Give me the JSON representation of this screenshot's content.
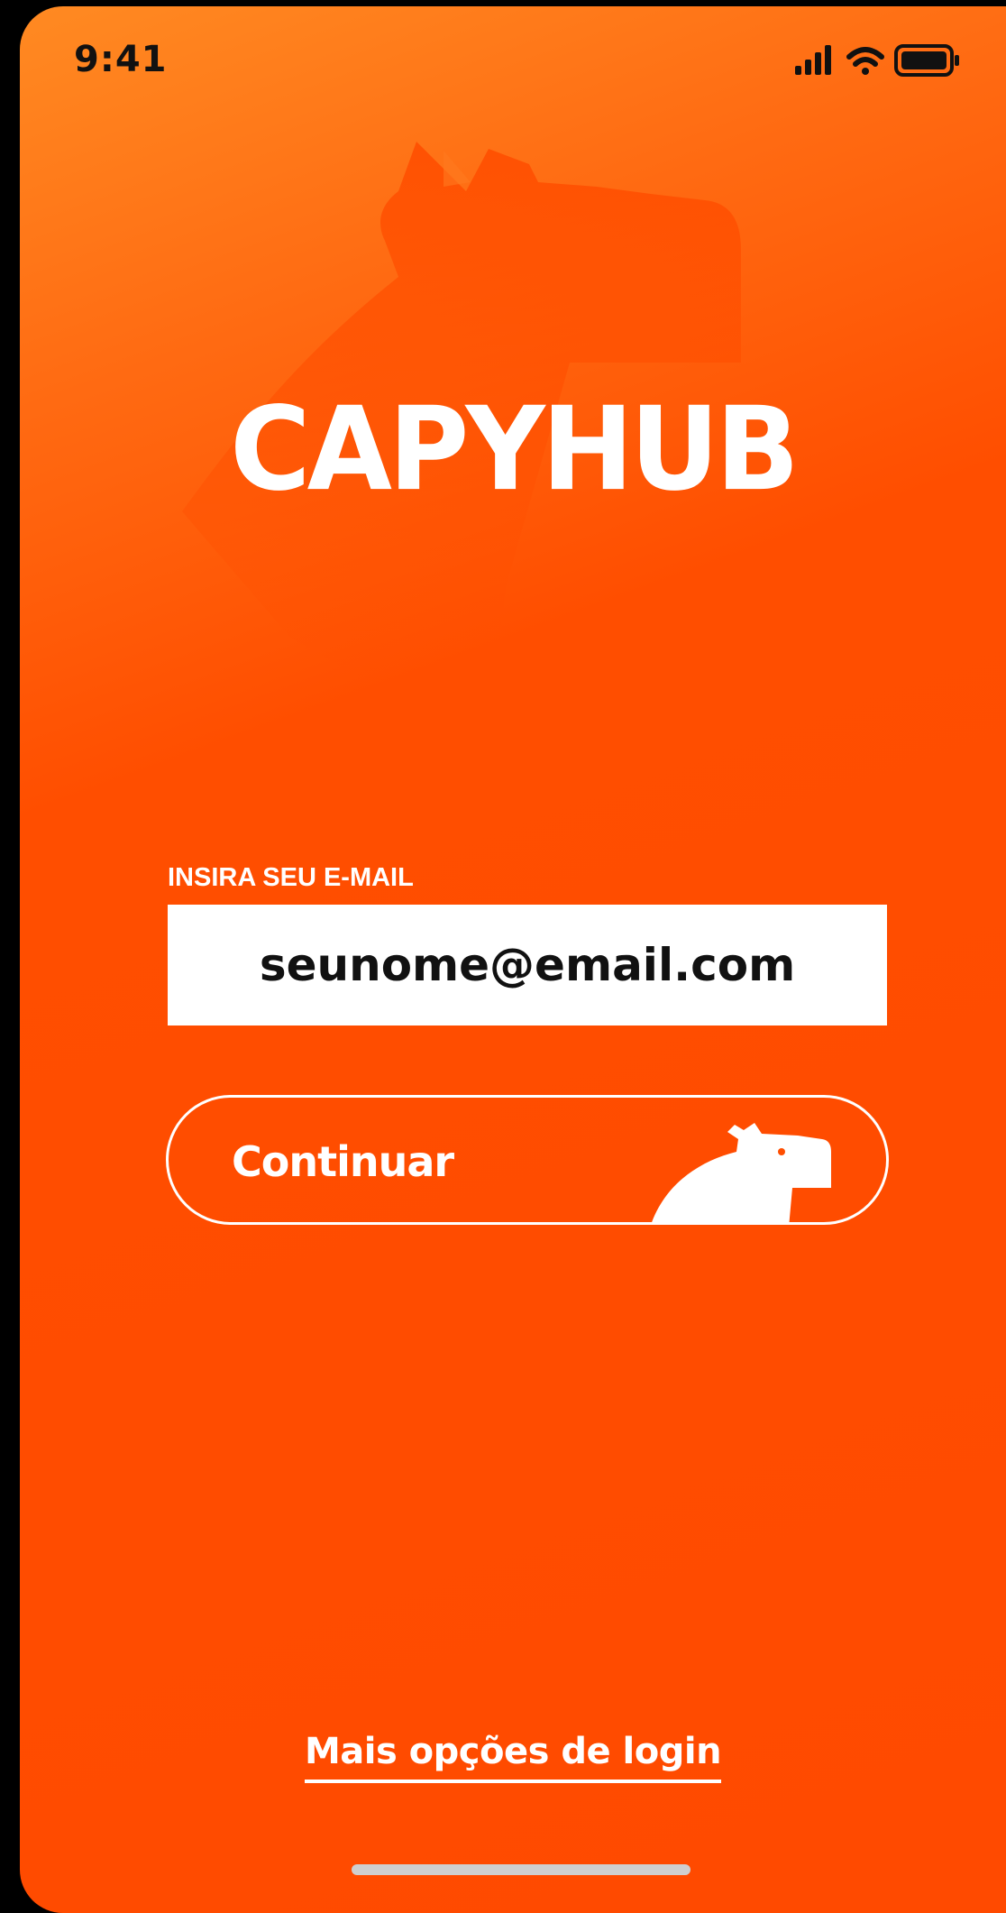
{
  "status_bar": {
    "time": "9:41",
    "icons": [
      "cellular-signal-icon",
      "wifi-icon",
      "battery-icon"
    ]
  },
  "brand": {
    "logo_text": "CAPYHUB",
    "primary_color": "#ff4e00",
    "accent_color": "#ffffff"
  },
  "login": {
    "email_label": "INSIRA SEU E-MAIL",
    "email_placeholder": "seunome@email.com",
    "email_value": "",
    "continue_label": "Continuar",
    "more_options_label": "Mais opções de login"
  }
}
